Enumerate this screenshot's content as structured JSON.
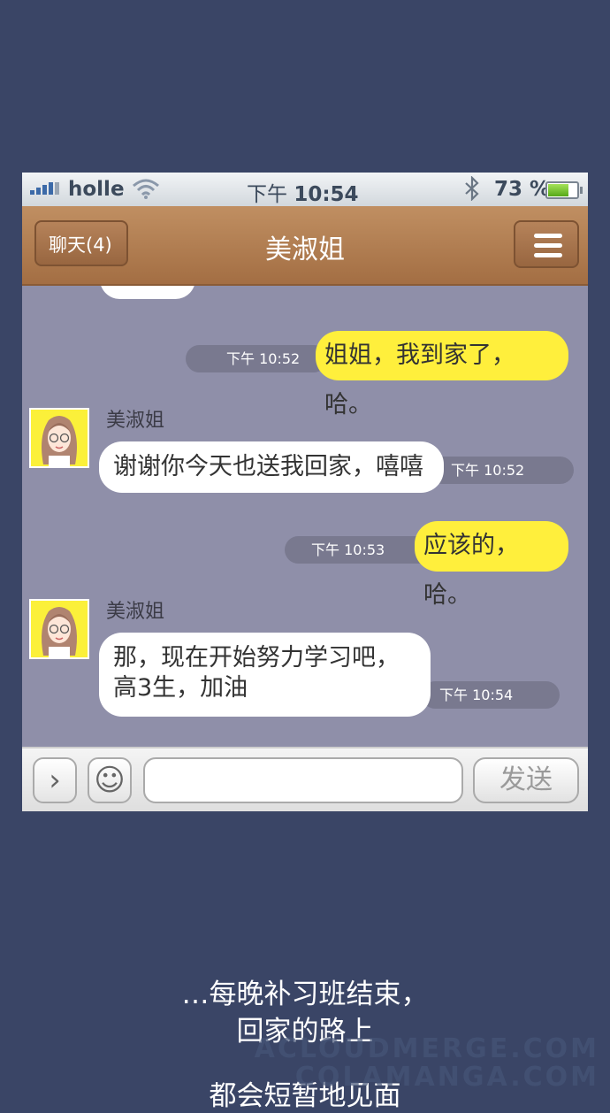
{
  "status_bar": {
    "carrier": "holle",
    "time_prefix": "下午",
    "time": "10:54",
    "battery_percent": "73 %",
    "battery_level": 0.73
  },
  "nav": {
    "back_label": "聊天(4)",
    "title": "美淑姐"
  },
  "messages": [
    {
      "from": "me",
      "text": "姐姐，我到家了，哈。",
      "time": "下午 10:52"
    },
    {
      "from": "美淑姐",
      "sender_name": "美淑姐",
      "text": "谢谢你今天也送我回家，嘻嘻",
      "time": "下午 10:52"
    },
    {
      "from": "me",
      "text": "应该的，哈。",
      "time": "下午 10:53"
    },
    {
      "from": "美淑姐",
      "sender_name": "美淑姐",
      "text_line1": "那，现在开始努力学习吧，",
      "text_line2": "高3生，加油",
      "time": "下午 10:54"
    }
  ],
  "input_bar": {
    "expand_glyph": "›",
    "emoji_glyph": "☺",
    "input_value": "",
    "send_label": "发送"
  },
  "narration": {
    "line1": "…每晚补习班结束，",
    "line2": "回家的路上",
    "line3": "都会短暂地见面"
  },
  "watermarks": [
    "ACLOUDMERGE.COM",
    "COLAMANGA.COM"
  ],
  "colors": {
    "background": "#3a4566",
    "nav_brown": "#a36e43",
    "chat_bg": "#8f8fa9",
    "my_bubble": "#ffef3c",
    "their_bubble": "#ffffff"
  }
}
